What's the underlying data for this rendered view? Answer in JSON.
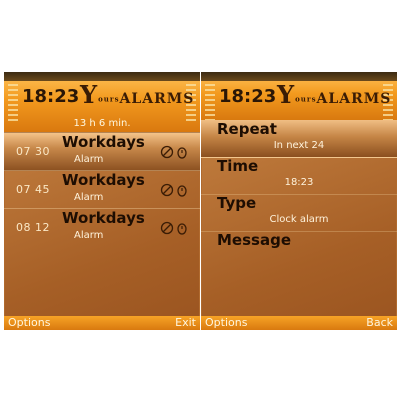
{
  "left_screen": {
    "clock": "18:23",
    "logo": {
      "first": "Y",
      "middle": "ours",
      "main": "ALARMS"
    },
    "next_alarm_info": "13 h 6 min.",
    "alarms": [
      {
        "time": "07 30",
        "title": "Workdays",
        "type": "Alarm",
        "selected": true
      },
      {
        "time": "07 45",
        "title": "Workdays",
        "type": "Alarm",
        "selected": false
      },
      {
        "time": "08 12",
        "title": "Workdays",
        "type": "Alarm",
        "selected": false
      }
    ],
    "softkeys": {
      "left": "Options",
      "right": "Exit"
    }
  },
  "right_screen": {
    "clock": "18:23",
    "logo": {
      "first": "Y",
      "middle": "ours",
      "main": "ALARMS"
    },
    "fields": [
      {
        "label": "Repeat",
        "value": "In next 24"
      },
      {
        "label": "Time",
        "value": "18:23"
      },
      {
        "label": "Type",
        "value": "Clock alarm"
      },
      {
        "label": "Message",
        "value": ""
      }
    ],
    "softkeys": {
      "left": "Options",
      "right": "Back"
    }
  },
  "colors": {
    "header_orange": "#f39a1e",
    "body_brown": "#b06a2e",
    "selection": "#c7884a",
    "dark_text": "#1d0d02"
  },
  "icons": [
    "signal-bars-icon",
    "alarm-status-icon",
    "alarm-clock-icon"
  ]
}
